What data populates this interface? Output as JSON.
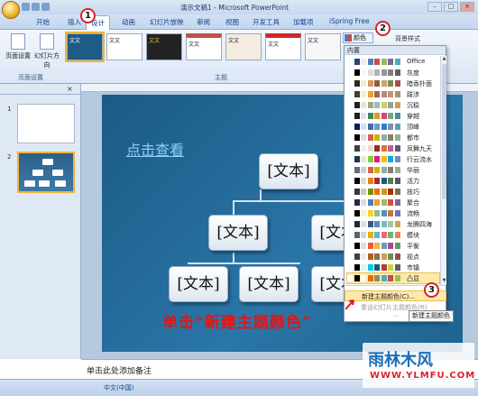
{
  "window": {
    "title": "演示文稿1 - Microsoft PowerPoint",
    "minimize": "–",
    "maximize": "□",
    "close": "×"
  },
  "tabs": [
    {
      "label": "开始"
    },
    {
      "label": "插入"
    },
    {
      "label": "设计",
      "active": true
    },
    {
      "label": "动画"
    },
    {
      "label": "幻灯片放映"
    },
    {
      "label": "审阅"
    },
    {
      "label": "视图"
    },
    {
      "label": "开发工具"
    },
    {
      "label": "加载项"
    },
    {
      "label": "iSpring Free"
    }
  ],
  "ribbon": {
    "page_setup": "页面设置",
    "slide_orientation": "幻灯片方向",
    "group_page_setup": "页面设置",
    "group_theme": "主题",
    "theme_thumb_text": [
      "文文",
      "文文",
      "文文",
      "文文",
      "文文",
      "文文",
      "文文"
    ],
    "colors_button": "颜色",
    "background_styles": "背景样式"
  },
  "slide_pane": {
    "tab_outline": "",
    "close": "×",
    "slide_numbers": [
      "1",
      "2"
    ]
  },
  "slide": {
    "link_text": "点击查看",
    "nodes": [
      "[文本]",
      "[文本]",
      "[文本]",
      "[文本]",
      "[文本]",
      "[文本]",
      "[文本]"
    ]
  },
  "dropdown": {
    "header": "内置",
    "items": [
      {
        "label": "Office",
        "colors": [
          "#ffffff",
          "#1f497d",
          "#eeece1",
          "#4f81bd",
          "#c0504d",
          "#9bbb59",
          "#8064a2",
          "#4bacc6"
        ]
      },
      {
        "label": "灰度",
        "colors": [
          "#ffffff",
          "#000000",
          "#f8f8f8",
          "#dddddd",
          "#b2b2b2",
          "#969696",
          "#808080",
          "#5f5f5f"
        ]
      },
      {
        "label": "暗香扑面",
        "colors": [
          "#ffffff",
          "#2f2b20",
          "#f6e9d7",
          "#d89a5b",
          "#8b5e3c",
          "#c6a36f",
          "#7e8a4f",
          "#a35049"
        ]
      },
      {
        "label": "跋涉",
        "colors": [
          "#ffffff",
          "#4e3b30",
          "#fbeec9",
          "#f0a22e",
          "#a5644e",
          "#b58b80",
          "#c3986d",
          "#a19574"
        ]
      },
      {
        "label": "沉稳",
        "colors": [
          "#ffffff",
          "#1f2327",
          "#e9e5dc",
          "#a9a57c",
          "#9cbebd",
          "#d2cb6c",
          "#95a39d",
          "#c89f5d"
        ]
      },
      {
        "label": "穿越",
        "colors": [
          "#ffffff",
          "#202020",
          "#dfe3e5",
          "#3e8853",
          "#e19825",
          "#d54773",
          "#7da67f",
          "#4c8c9f"
        ]
      },
      {
        "label": "顶峰",
        "colors": [
          "#ffffff",
          "#002060",
          "#d2e1f3",
          "#4a66ac",
          "#629dd1",
          "#297fd5",
          "#7f8fa9",
          "#5aa2ae"
        ]
      },
      {
        "label": "都市",
        "colors": [
          "#ffffff",
          "#000000",
          "#dedede",
          "#d16349",
          "#ccb400",
          "#8cadae",
          "#8c7b70",
          "#8fb08c"
        ]
      },
      {
        "label": "凤舞九天",
        "colors": [
          "#ffffff",
          "#3f3f3f",
          "#f2f2f2",
          "#e3ded1",
          "#9c2826",
          "#d9752b",
          "#bf5e8f",
          "#65548a"
        ]
      },
      {
        "label": "行云流水",
        "colors": [
          "#ffffff",
          "#17375e",
          "#ece9c6",
          "#7fd13b",
          "#ea157a",
          "#feb80a",
          "#00addc",
          "#738ac8"
        ]
      },
      {
        "label": "华丽",
        "colors": [
          "#ffffff",
          "#646b86",
          "#c5d1d7",
          "#d16349",
          "#ccb400",
          "#8cadae",
          "#8c7b70",
          "#8fb08c"
        ]
      },
      {
        "label": "活力",
        "colors": [
          "#ffffff",
          "#000000",
          "#e2d8c9",
          "#f07f09",
          "#9f2936",
          "#1b587c",
          "#4e8542",
          "#604878"
        ]
      },
      {
        "label": "技巧",
        "colors": [
          "#ffffff",
          "#373545",
          "#cfc6be",
          "#6e9400",
          "#e96d08",
          "#c89a2c",
          "#ad3300",
          "#7f6b57"
        ]
      },
      {
        "label": "聚合",
        "colors": [
          "#ffffff",
          "#242852",
          "#dcdce3",
          "#4a7ec4",
          "#ef9d2d",
          "#a2b969",
          "#d64c45",
          "#7b6598"
        ]
      },
      {
        "label": "流畅",
        "colors": [
          "#ffffff",
          "#000000",
          "#fbeec9",
          "#f8d22b",
          "#8fbc8f",
          "#5c8db8",
          "#c07945",
          "#7c6fb0"
        ]
      },
      {
        "label": "龙腾四海",
        "colors": [
          "#ffffff",
          "#1b2b39",
          "#d7e1e8",
          "#3c5a7e",
          "#5b8ab3",
          "#7ab8cc",
          "#a0c8a8",
          "#cda453"
        ]
      },
      {
        "label": "模块",
        "colors": [
          "#ffffff",
          "#5a6378",
          "#d4d4d6",
          "#f0ad00",
          "#60b5cc",
          "#e66c7d",
          "#6bb76d",
          "#e88651"
        ]
      },
      {
        "label": "平衡",
        "colors": [
          "#ffffff",
          "#000000",
          "#e3ded1",
          "#f05a33",
          "#f8b23e",
          "#6b9ab8",
          "#a34a9a",
          "#5f9e5a"
        ]
      },
      {
        "label": "视点",
        "colors": [
          "#ffffff",
          "#404040",
          "#eeece1",
          "#b85a22",
          "#8a6e4b",
          "#c7a15a",
          "#6e8a4a",
          "#9a4a4a"
        ]
      },
      {
        "label": "市镇",
        "colors": [
          "#ffffff",
          "#000000",
          "#dbf5f9",
          "#03c5ec",
          "#0b5f78",
          "#ba3b2c",
          "#c4d53d",
          "#5f5f5f"
        ]
      },
      {
        "label": "凸显",
        "colors": [
          "#ffffff",
          "#000000",
          "#f8f8f8",
          "#e36c09",
          "#948a54",
          "#4bacc6",
          "#c0504d",
          "#9bbb59"
        ]
      }
    ],
    "new_colors": "新建主题颜色(C)...",
    "reset_colors": "重设幻灯片主题颜色(R)",
    "grip": "⋯"
  },
  "tooltip": "新建主题颜色",
  "markers": [
    "1",
    "2",
    "3"
  ],
  "annotation": "单击“新建主题颜色”",
  "notes": "单击此处添加备注",
  "status": {
    "slide_info": "",
    "language": "中文(中国)"
  },
  "watermark": {
    "title": "雨林木风",
    "url": "WWW.YLMFU.COM"
  },
  "colors": {
    "accent": "#d8232a",
    "ribbon": "#dbe6f5",
    "slide_bg": "#2a76a8"
  }
}
